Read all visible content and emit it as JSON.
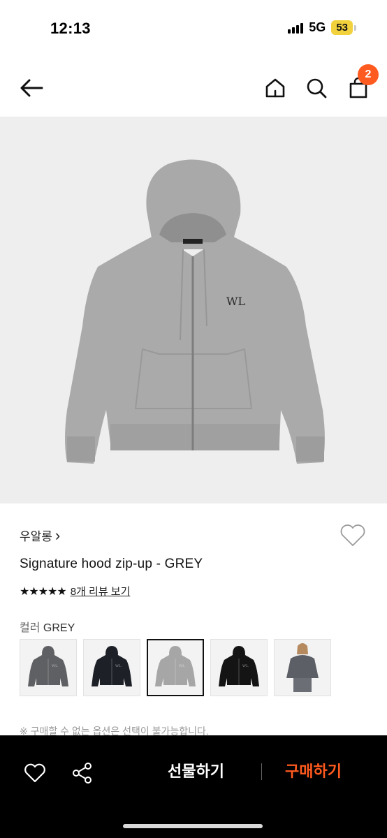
{
  "status_bar": {
    "time": "12:13",
    "network": "5G",
    "battery": "53"
  },
  "nav": {
    "cart_count": "2",
    "icons": [
      "back-arrow-icon",
      "home-icon",
      "search-icon",
      "shopping-bag-icon"
    ]
  },
  "product": {
    "brand": "우알롱",
    "brand_chevron": "›",
    "name": "Signature hood zip-up - GREY",
    "stars": "★★★★★",
    "review_link": "8개 리뷰 보기",
    "color_label": "컬러",
    "color_value": "GREY",
    "image_color": "#a9a9a9",
    "swatches": [
      {
        "color": "#5f6063",
        "kind": "hoodie"
      },
      {
        "color": "#1d2027",
        "kind": "hoodie"
      },
      {
        "color": "#a6a6a6",
        "kind": "hoodie",
        "selected": true
      },
      {
        "color": "#141414",
        "kind": "hoodie"
      },
      {
        "color": "#5c5f66",
        "kind": "model"
      }
    ],
    "notice": "※ 구매할 수 없는 옵션은 선택이 불가능합니다."
  },
  "bottom_bar": {
    "gift_label": "선물하기",
    "buy_label": "구매하기",
    "accent_color": "#ff5a1f"
  }
}
